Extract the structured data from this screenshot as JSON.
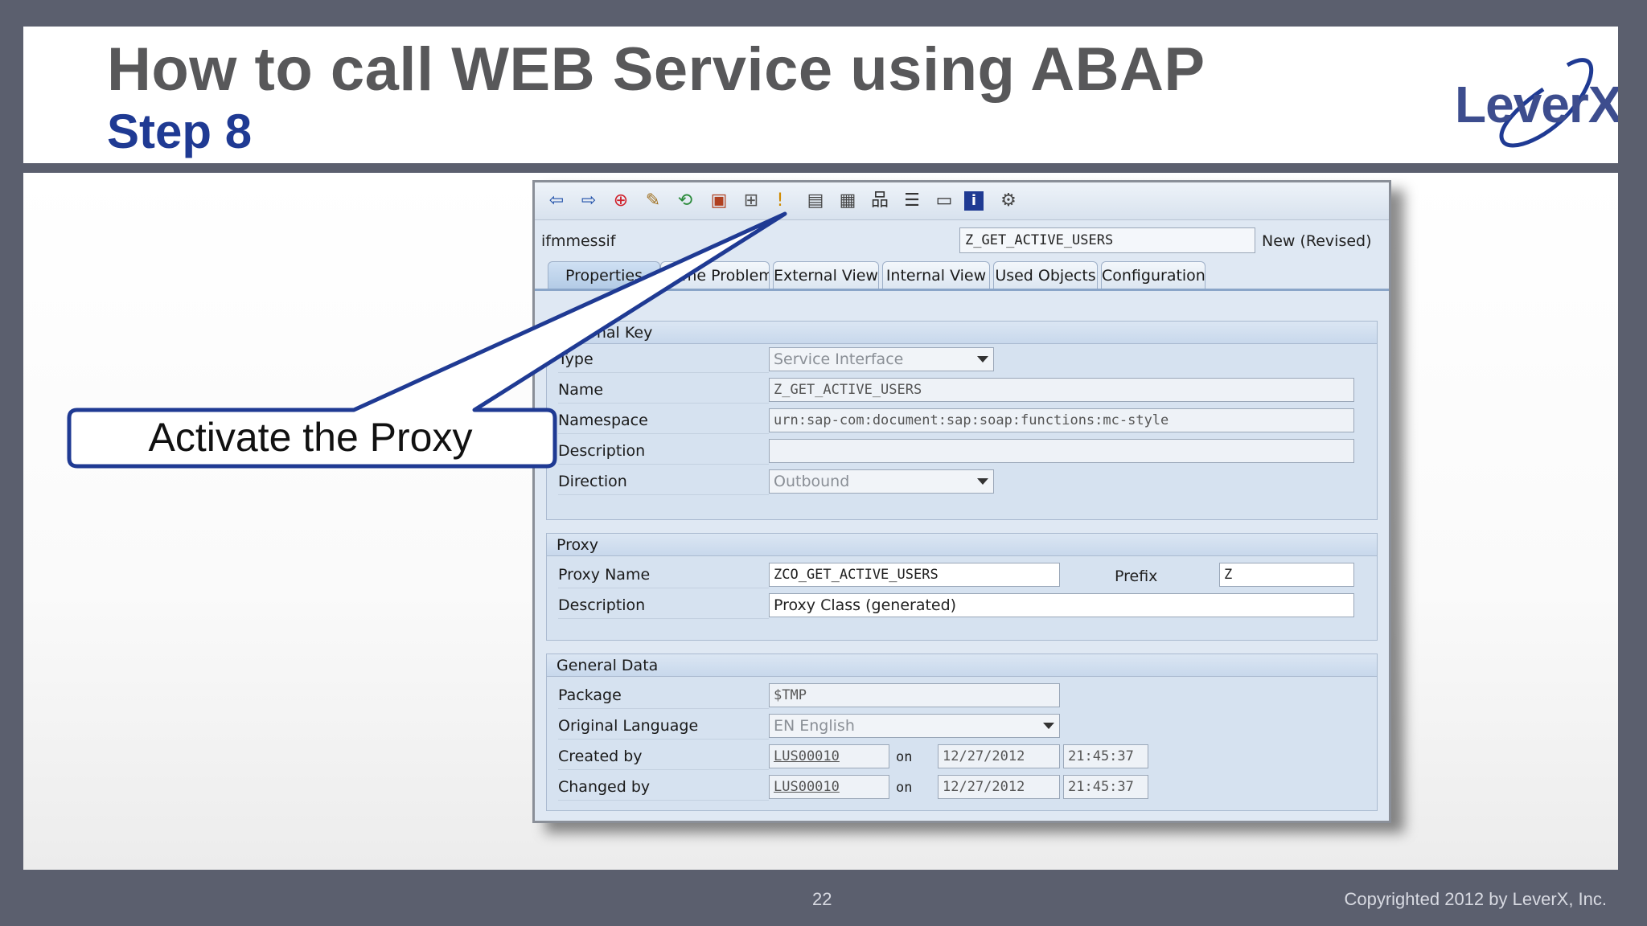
{
  "slide": {
    "title": "How to call WEB Service using ABAP",
    "subtitle": "Step 8",
    "logo_text": "LeverX",
    "page_number": "22",
    "copyright": "Copyrighted 2012 by LeverX, Inc."
  },
  "callout": {
    "text": "Activate the Proxy"
  },
  "sap": {
    "toolbar_icons": [
      "back-icon",
      "forward-icon",
      "exit-icon",
      "edit-icon",
      "compare-icon",
      "check-icon",
      "hierarchy-icon",
      "activate-icon",
      "display-icon",
      "object-list-icon",
      "structure-icon",
      "print-icon",
      "list-icon",
      "info-icon",
      "settings-icon"
    ],
    "header": {
      "object_type": "ifmmessif",
      "object_name": "Z_GET_ACTIVE_USERS",
      "status": "New (Revised)"
    },
    "tabs": [
      "Properties",
      "Name Problems",
      "External View",
      "Internal View",
      "Used Objects",
      "Configuration"
    ],
    "external_key": {
      "title": "External Key",
      "type_label": "Type",
      "type_value": "Service Interface",
      "name_label": "Name",
      "name_value": "Z_GET_ACTIVE_USERS",
      "namespace_label": "Namespace",
      "namespace_value": "urn:sap-com:document:sap:soap:functions:mc-style",
      "description_label": "Description",
      "description_value": "",
      "direction_label": "Direction",
      "direction_value": "Outbound"
    },
    "proxy": {
      "title": "Proxy",
      "proxy_name_label": "Proxy Name",
      "proxy_name_value": "ZCO_GET_ACTIVE_USERS",
      "prefix_label": "Prefix",
      "prefix_value": "Z",
      "description_label": "Description",
      "description_value": "Proxy Class (generated)"
    },
    "general_data": {
      "title": "General Data",
      "package_label": "Package",
      "package_value": "$TMP",
      "language_label": "Original Language",
      "language_value": "EN English",
      "created_by_label": "Created by",
      "created_by_value": "LUS00010",
      "created_on_label": "on",
      "created_date": "12/27/2012",
      "created_time": "21:45:37",
      "changed_by_label": "Changed by",
      "changed_by_value": "LUS00010",
      "changed_on_label": "on",
      "changed_date": "12/27/2012",
      "changed_time": "21:45:37"
    }
  },
  "colors": {
    "title_gray": "#58585a",
    "subtitle_blue": "#1f3a93",
    "frame": "#5b5f6e",
    "callout_border": "#1f3a93"
  }
}
